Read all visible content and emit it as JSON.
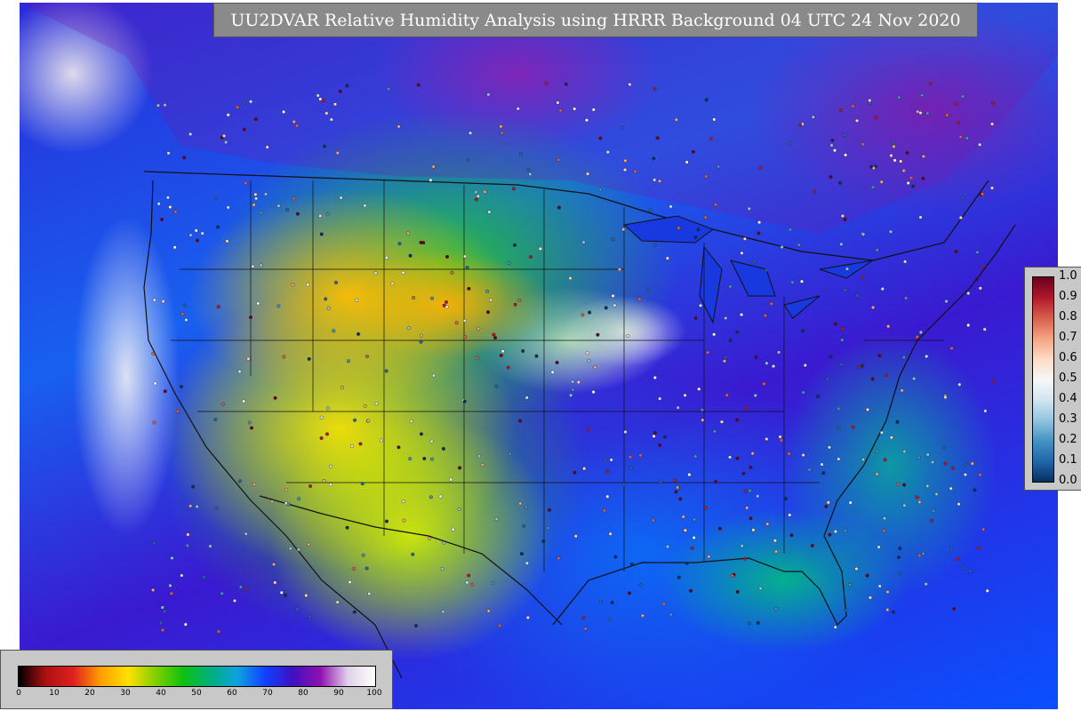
{
  "title": "UU2DVAR Relative Humidity Analysis using HRRR Background 04 UTC 24 Nov 2020",
  "rh_colorbar": {
    "ticks": [
      "0",
      "10",
      "20",
      "30",
      "40",
      "50",
      "60",
      "70",
      "80",
      "90",
      "100"
    ],
    "colors": [
      "#000000",
      "#b01010",
      "#e02020",
      "#ffa000",
      "#ffe000",
      "#80d000",
      "#10c010",
      "#00b080",
      "#10a0e0",
      "#1040ff",
      "#4010c0",
      "#9010b0",
      "#e0d0e8",
      "#ffffff"
    ]
  },
  "obs_colorbar": {
    "ticks": [
      "1.0",
      "0.9",
      "0.8",
      "0.7",
      "0.6",
      "0.5",
      "0.4",
      "0.3",
      "0.2",
      "0.1",
      "0.0"
    ],
    "colors": [
      "#67001f",
      "#b2182b",
      "#d6604d",
      "#f4a582",
      "#fddbc7",
      "#f7f7f7",
      "#d1e5f0",
      "#92c5de",
      "#4393c3",
      "#2166ac",
      "#053061"
    ]
  }
}
